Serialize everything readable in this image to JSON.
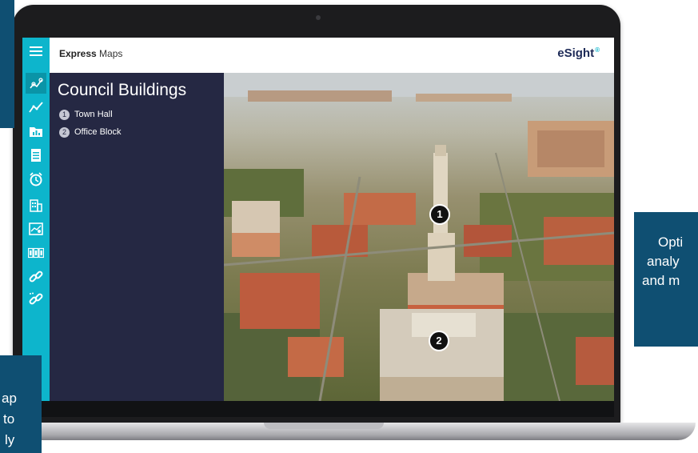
{
  "app": {
    "title_bold": "Express",
    "title_rest": " Maps",
    "brand": "eSight",
    "brand_mark": "®"
  },
  "panel": {
    "title": "Council Buildings",
    "items": [
      {
        "num": "1",
        "label": "Town Hall"
      },
      {
        "num": "2",
        "label": "Office Block"
      }
    ]
  },
  "map": {
    "markers": [
      {
        "num": "1"
      },
      {
        "num": "2"
      }
    ]
  },
  "rail": {
    "icons": [
      "menu-icon",
      "map-pins-icon",
      "trend-line-icon",
      "bar-report-icon",
      "calendar-sheet-icon",
      "alarm-clock-icon",
      "buildings-icon",
      "dashboard-icon",
      "counter-icon",
      "link-icon",
      "link-dotted-icon"
    ]
  },
  "callouts": {
    "right_lines": [
      "Opti",
      "analy",
      "and m"
    ],
    "left_lines": [
      "ap",
      "to",
      "ly"
    ]
  },
  "colors": {
    "rail": "#0db5cc",
    "panel": "#252843",
    "callout": "#0f4f72",
    "brand": "#1d2a57"
  }
}
